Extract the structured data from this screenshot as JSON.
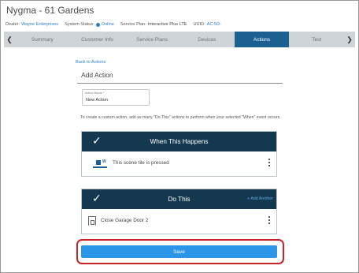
{
  "page": {
    "title": "Nygma - 61 Gardens"
  },
  "status": {
    "dealer_label": "Dealer:",
    "dealer_value": "Wayne Enterprises",
    "system_status_label": "System Status:",
    "system_status_value": "Online",
    "service_plan_label": "Service Plan:",
    "service_plan_value": "Interactive Plus LTE",
    "uuid_label": "UUID:",
    "uuid_value": "AC:5D:",
    "status_color": "#2a7fc4"
  },
  "tabs": {
    "prev_icon": "chevron-left-icon",
    "next_icon": "chevron-right-icon",
    "items": [
      {
        "label": "Summary"
      },
      {
        "label": "Customer Info"
      },
      {
        "label": "Service Plans"
      },
      {
        "label": "Devices"
      },
      {
        "label": "Actions"
      },
      {
        "label": "Test"
      }
    ],
    "active_label": "Actions",
    "active_color": "#1c5f91"
  },
  "main": {
    "back_link": "Back to Actions",
    "section_title": "Add Action",
    "action_name": {
      "label": "Action Name *",
      "value": "New Action"
    },
    "description": "To create a custom action, add as many \"Do This\" actions to perform when your selected \"When\" event occurs.",
    "when_card": {
      "title": "When This Happens",
      "icon": "check-icon",
      "row_icon": "scene-tile-icon",
      "row_text": "This scene tile is pressed",
      "menu_icon": "kebab-menu-icon"
    },
    "do_card": {
      "title": "Do This",
      "icon": "check-icon",
      "add_another": "+ Add Another",
      "row_icon": "garage-door-icon",
      "row_text": "Close Garage Door 2",
      "menu_icon": "kebab-menu-icon"
    },
    "save_label": "Save",
    "header_color": "#13384f",
    "save_color": "#2b96e8",
    "highlight_color": "#cc2127"
  }
}
